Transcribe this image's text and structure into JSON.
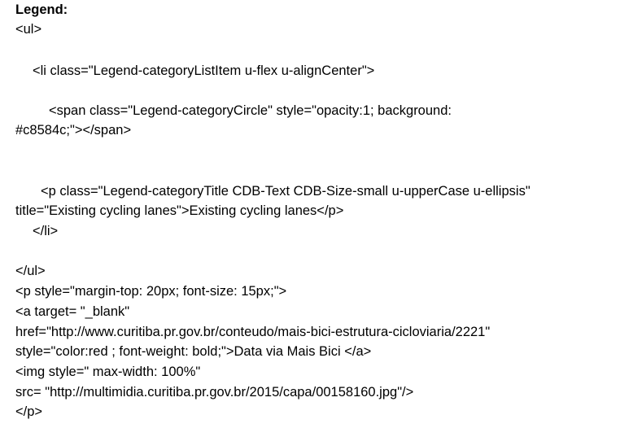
{
  "document": {
    "heading": "Legend:",
    "lines": [
      "<ul>",
      "<li class=\"Legend-categoryListItem u-flex u-alignCenter\">",
      "<span class=\"Legend-categoryCircle\" style=\"opacity:1; background:",
      "#c8584c;\"></span>",
      "<p class=\"Legend-categoryTitle CDB-Text CDB-Size-small u-upperCase u-ellipsis\"",
      "title=\"Existing cycling lanes\">Existing cycling lanes</p>",
      "</li>",
      "</ul>",
      "<p style=\"margin-top: 20px; font-size: 15px;\">",
      "<a target= \"_blank\"",
      "href=\"http://www.curitiba.pr.gov.br/conteudo/mais-bici-estrutura-cicloviaria/2221\"",
      "style=\"color:red ; font-weight: bold;\">Data via Mais Bici </a>",
      "<img style=\" max-width: 100%\"",
      "src= \"http://multimidia.curitiba.pr.gov.br/2015/capa/00158160.jpg\"/>",
      "</p>"
    ]
  }
}
